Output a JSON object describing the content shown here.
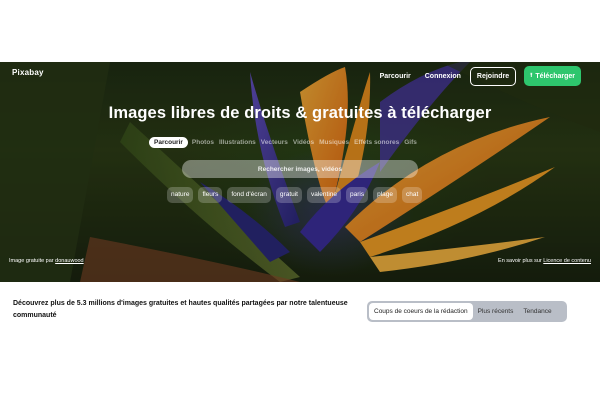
{
  "header": {
    "logo": "Pixabay",
    "nav": {
      "explore": "Parcourir",
      "login": "Connexion",
      "join": "Rejoindre",
      "upload": "Télécharger"
    }
  },
  "hero": {
    "title": "Images libres de droits & gratuites à télécharger",
    "tabs": [
      {
        "label": "Parcourir",
        "active": true
      },
      {
        "label": "Photos"
      },
      {
        "label": "Illustrations"
      },
      {
        "label": "Vecteurs"
      },
      {
        "label": "Vidéos"
      },
      {
        "label": "Musiques"
      },
      {
        "label": "Effets sonores"
      },
      {
        "label": "Gifs"
      }
    ],
    "search": {
      "placeholder": "Rechercher images, vidéos"
    },
    "chips": [
      "nature",
      "fleurs",
      "fond d'écran",
      "gratuit",
      "valentine",
      "paris",
      "plage",
      "chat"
    ],
    "credit": {
      "prefix": "Image gratuite par ",
      "author": "donauwood"
    },
    "learn_more": {
      "prefix": "En savoir plus sur ",
      "link": "Licence de contenu"
    }
  },
  "main": {
    "description": "Découvrez plus de 5.3 millions d'images gratuites et hautes qualités partagées par notre talentueuse communauté",
    "filters": [
      {
        "label": "Coups de coeurs de la rédaction",
        "active": true
      },
      {
        "label": "Plus récents"
      },
      {
        "label": "Tendance"
      }
    ]
  },
  "colors": {
    "accent": "#2ec66d",
    "filter_bar": "#b9bec7"
  },
  "icons": {
    "upload": "upload-arrow-icon"
  }
}
